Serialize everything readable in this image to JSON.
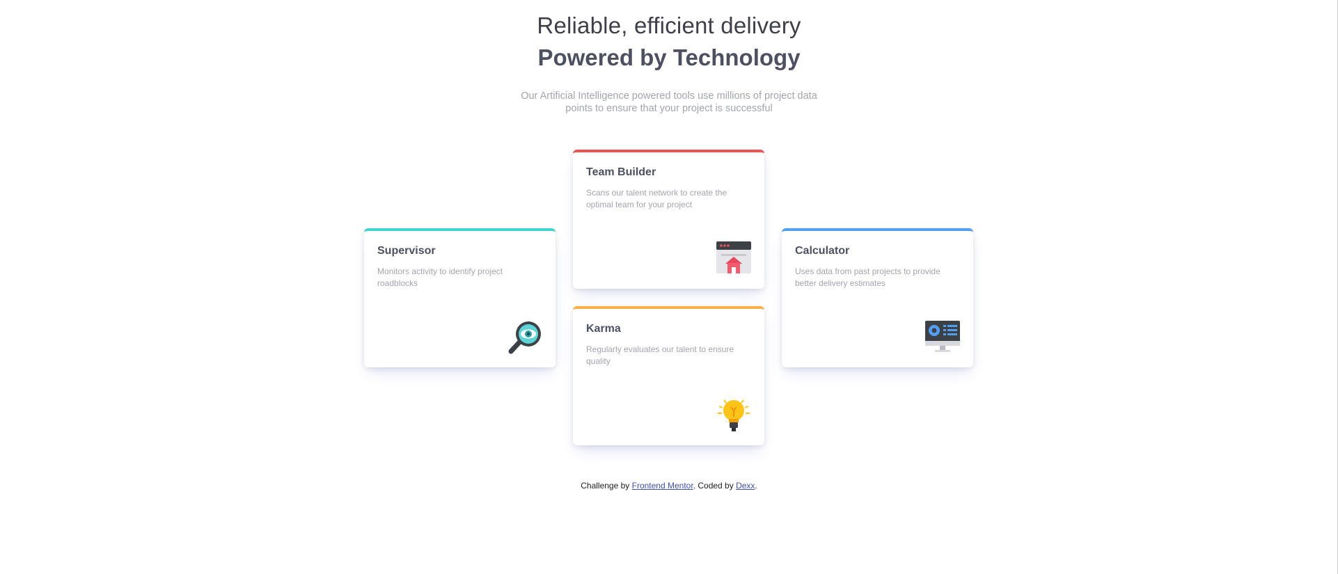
{
  "header": {
    "headline_light": "Reliable, efficient delivery",
    "headline_bold": "Powered by Technology",
    "intro": "Our Artificial Intelligence powered tools use millions of project data points to ensure that your project is successful"
  },
  "cards": {
    "supervisor": {
      "title": "Supervisor",
      "description": "Monitors activity to identify project roadblocks",
      "icon": "magnifying-glass-eye-icon",
      "accent": "#44d3d2"
    },
    "team_builder": {
      "title": "Team Builder",
      "description": "Scans our talent network to create the optimal team for your project",
      "icon": "team-builder-icon",
      "accent": "#ea5454"
    },
    "karma": {
      "title": "Karma",
      "description": "Regularly evaluates our talent to ensure quality",
      "icon": "lightbulb-icon",
      "accent": "#fcae4a"
    },
    "calculator": {
      "title": "Calculator",
      "description": "Uses data from past projects to provide better delivery estimates",
      "icon": "monitor-calculator-icon",
      "accent": "#549ef2"
    }
  },
  "attribution": {
    "prefix": "Challenge by ",
    "frontend_mentor": "Frontend Mentor",
    "middle": ". Coded by ",
    "author": "Dexx",
    "suffix": "."
  }
}
